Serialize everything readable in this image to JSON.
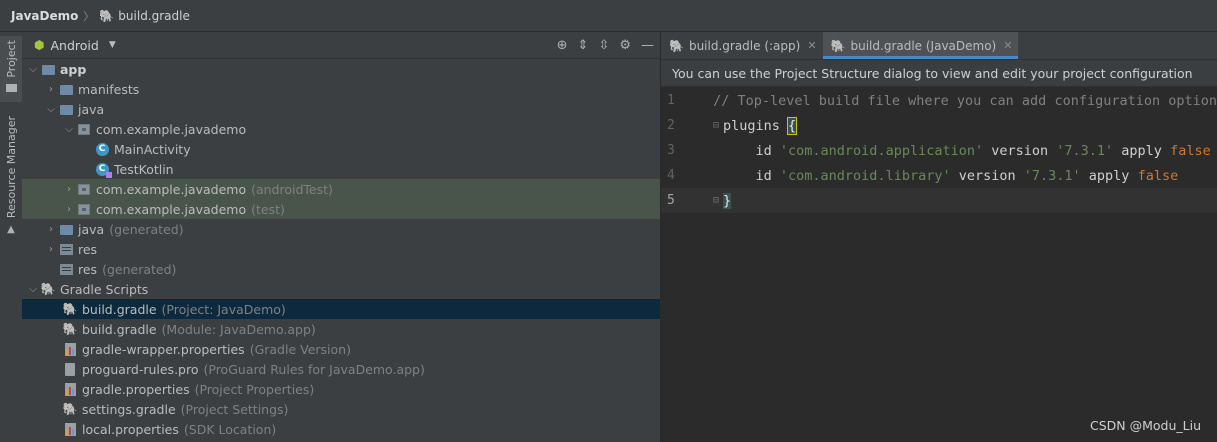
{
  "breadcrumb": {
    "root": "JavaDemo",
    "file": "build.gradle"
  },
  "side_tabs": {
    "project": "Project",
    "resource_manager": "Resource Manager"
  },
  "project_panel": {
    "view_mode": "Android",
    "tree": [
      {
        "label": "app",
        "hint": "",
        "bold": true
      },
      {
        "label": "manifests",
        "hint": ""
      },
      {
        "label": "java",
        "hint": ""
      },
      {
        "label": "com.example.javademo",
        "hint": ""
      },
      {
        "label": "MainActivity",
        "hint": ""
      },
      {
        "label": "TestKotlin",
        "hint": ""
      },
      {
        "label": "com.example.javademo",
        "hint": "(androidTest)"
      },
      {
        "label": "com.example.javademo",
        "hint": "(test)"
      },
      {
        "label": "java",
        "hint": "(generated)"
      },
      {
        "label": "res",
        "hint": ""
      },
      {
        "label": "res",
        "hint": "(generated)"
      },
      {
        "label": "Gradle Scripts",
        "hint": ""
      },
      {
        "label": "build.gradle",
        "hint": "(Project: JavaDemo)"
      },
      {
        "label": "build.gradle",
        "hint": "(Module: JavaDemo.app)"
      },
      {
        "label": "gradle-wrapper.properties",
        "hint": "(Gradle Version)"
      },
      {
        "label": "proguard-rules.pro",
        "hint": "(ProGuard Rules for JavaDemo.app)"
      },
      {
        "label": "gradle.properties",
        "hint": "(Project Properties)"
      },
      {
        "label": "settings.gradle",
        "hint": "(Project Settings)"
      },
      {
        "label": "local.properties",
        "hint": "(SDK Location)"
      }
    ]
  },
  "editor": {
    "tabs": [
      {
        "label": "build.gradle (:app)",
        "active": false
      },
      {
        "label": "build.gradle (JavaDemo)",
        "active": true
      }
    ],
    "notice": "You can use the Project Structure dialog to view and edit your project configuration",
    "line_numbers": [
      "1",
      "2",
      "3",
      "4",
      "5"
    ],
    "code": {
      "line1_comment": "// Top-level build file where you can add configuration option",
      "line2_ident": "plugins ",
      "line2_brace": "{",
      "line3_id": "    id ",
      "line3_plugin": "'com.android.application'",
      "line3_version_kw": " version ",
      "line3_version": "'7.3.1'",
      "line3_apply": " apply ",
      "line3_false": "false",
      "line4_id": "    id ",
      "line4_plugin": "'com.android.library'",
      "line4_version_kw": " version ",
      "line4_version": "'7.3.1'",
      "line4_apply": " apply ",
      "line4_false": "false",
      "line5_brace": "}"
    }
  },
  "watermark": "CSDN @Modu_Liu",
  "colors": {
    "selection": "#0d293e",
    "test_rows": "#49544a",
    "accent": "#4a88c7"
  }
}
